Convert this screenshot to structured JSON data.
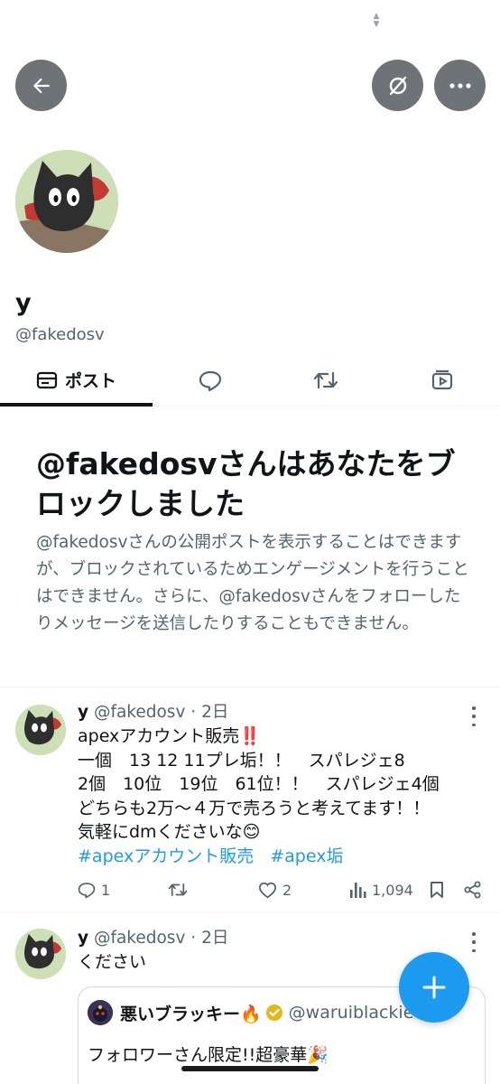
{
  "colors": {
    "accent": "#1d9bf0",
    "text_primary": "#0f1419",
    "text_secondary": "#536471",
    "header_button_bg": "#6e7378",
    "divider": "#eff3f4",
    "block_badge": "#f4212e"
  },
  "header": {
    "icons": [
      "arrow-left-icon",
      "translate-icon",
      "more-horizontal-icon"
    ]
  },
  "profile": {
    "display_name": "y",
    "handle": "@fakedosv"
  },
  "tabs": [
    {
      "label": "ポスト",
      "icon": "posts-icon",
      "active": true
    },
    {
      "label": "",
      "icon": "replies-icon",
      "active": false
    },
    {
      "label": "",
      "icon": "repost-icon",
      "active": false
    },
    {
      "label": "",
      "icon": "media-icon",
      "active": false
    }
  ],
  "block_notice": {
    "title": "@fakedosvさんはあなたをブロックしました",
    "description": "@fakedosvさんの公開ポストを表示することはできますが、ブロックされているためエンゲージメントを行うことはできません。さらに、@fakedosvさんをフォローしたりメッセージを送信したりすることもできません。"
  },
  "posts": [
    {
      "name": "y",
      "handle": "@fakedosv",
      "time": "2日",
      "text": "apexアカウント販売‼️\n一個　13 12 11プレ垢！！　スパレジェ8\n2個　10位　19位　61位！！　スパレジェ4個\nどちらも2万〜４万で売ろうと考えてます！！\n気軽にdmくださいな😊",
      "hashtags": [
        "#apexアカウント販売",
        "#apex垢"
      ],
      "stats": {
        "replies": "1",
        "reposts": "",
        "likes": "2",
        "views": "1,094"
      }
    },
    {
      "name": "y",
      "handle": "@fakedosv",
      "time": "2日",
      "text": "ください",
      "quote": {
        "name": "悪いブラッキー🔥",
        "handle": "@waruiblackie",
        "text": "フォロワーさん限定!!超豪華🎉"
      }
    }
  ],
  "fab": {
    "icon": "plus-icon"
  }
}
